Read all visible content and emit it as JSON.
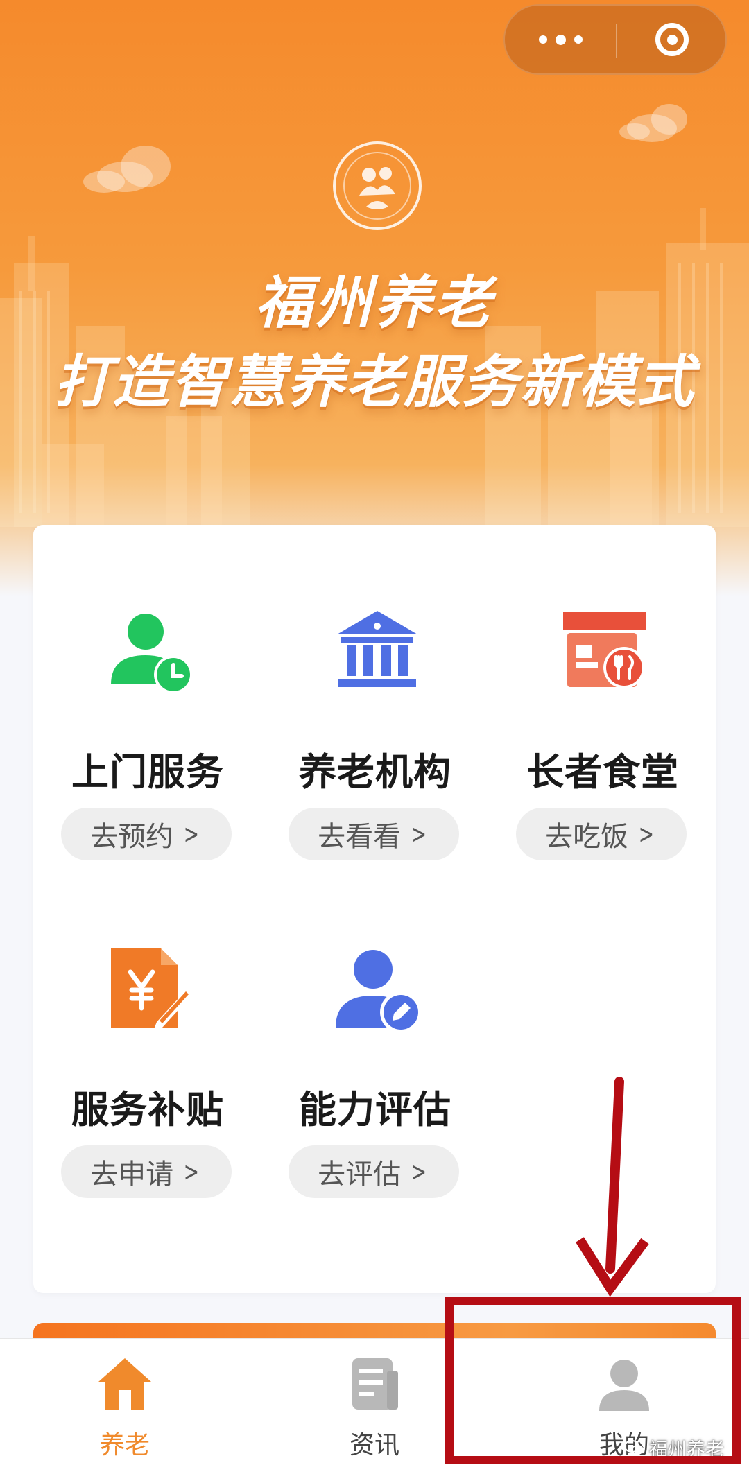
{
  "hero": {
    "title_line1": "福州养老",
    "title_line2": "打造智慧养老服务新模式"
  },
  "capsule": {
    "more_icon": "more-dots-icon",
    "close_icon": "close-target-icon"
  },
  "services": [
    {
      "title": "上门服务",
      "action": "去预约",
      "icon": "home-visit-user-clock-icon",
      "color": "#22c55e"
    },
    {
      "title": "养老机构",
      "action": "去看看",
      "icon": "institution-building-icon",
      "color": "#4f6fe3"
    },
    {
      "title": "长者食堂",
      "action": "去吃饭",
      "icon": "canteen-store-icon",
      "color": "#e8503a"
    },
    {
      "title": "服务补贴",
      "action": "去申请",
      "icon": "subsidy-document-icon",
      "color": "#f07a27"
    },
    {
      "title": "能力评估",
      "action": "去评估",
      "icon": "assessment-user-edit-icon",
      "color": "#4f6fe3"
    }
  ],
  "tabs": [
    {
      "label": "养老",
      "icon": "home-icon",
      "active": true
    },
    {
      "label": "资讯",
      "icon": "news-icon",
      "active": false
    },
    {
      "label": "我的",
      "icon": "user-icon",
      "active": false
    }
  ],
  "watermark": "福州养老",
  "colors": {
    "brand_orange": "#f08a2c",
    "annotation_red": "#b50d14"
  }
}
